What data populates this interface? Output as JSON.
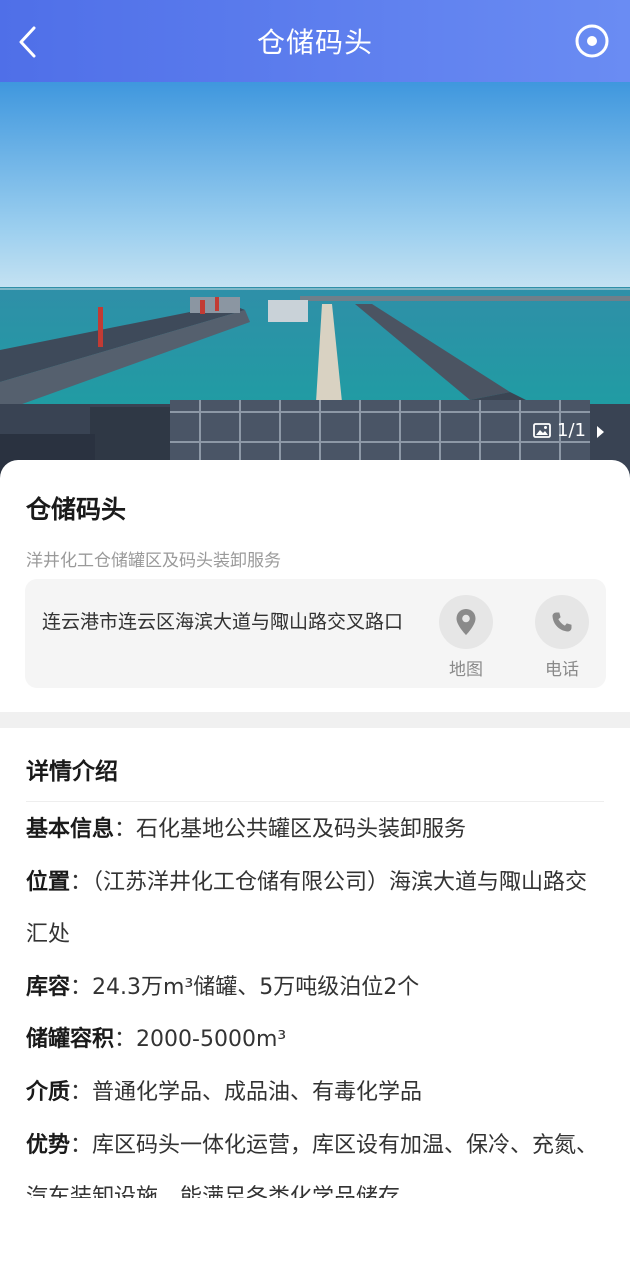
{
  "header": {
    "title": "仓储码头"
  },
  "gallery": {
    "counter": "1/1"
  },
  "place": {
    "name": "仓储码头",
    "subtitle": "洋井化工仓储罐区及码头装卸服务",
    "address": "连云港市连云区海滨大道与陬山路交叉路口",
    "map_label": "地图",
    "phone_label": "电话"
  },
  "details": {
    "title": "详情介绍",
    "basic_key": "基本信息",
    "basic_val": "石化基地公共罐区及码头装卸服务",
    "loc_key": "位置",
    "loc_val": "（江苏洋井化工仓储有限公司）海滨大道与陬山路交汇处",
    "cap_key": "库容",
    "cap_val": "24.3万m³储罐、5万吨级泊位2个",
    "tank_key": "储罐容积",
    "tank_val": "2000-5000m³",
    "medium_key": "介质",
    "medium_val": "普通化学品、成品油、有毒化学品",
    "adv_key": "优势",
    "adv_val": "库区码头一体化运营，库区设有加温、保冷、充氮、汽车装卸设施，能满足各类化学品储存"
  },
  "colors": {
    "header_start": "#4f6fe8",
    "header_end": "#6a8cf3"
  }
}
